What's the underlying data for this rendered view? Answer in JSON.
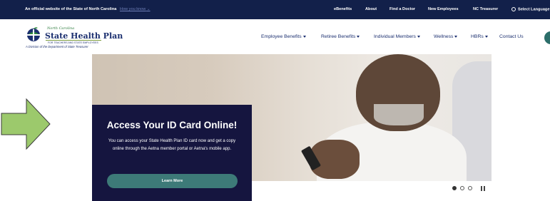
{
  "topbar": {
    "official_text": "An official website of the State of North Carolina",
    "how_you_know": "How you know",
    "links": [
      "eBenefits",
      "About",
      "Find a Doctor",
      "New Employees",
      "NC Treasurer"
    ],
    "language": "Select Language"
  },
  "logo": {
    "script": "North Carolina",
    "main": "State Health Plan",
    "sub": "FOR TEACHERS AND STATE EMPLOYEES",
    "division": "A Division of the Department of State Treasurer"
  },
  "nav": {
    "items": [
      {
        "label": "Employee Benefits",
        "dropdown": true
      },
      {
        "label": "Retiree Benefits",
        "dropdown": true
      },
      {
        "label": "Individual Members",
        "dropdown": true
      },
      {
        "label": "Wellness",
        "dropdown": true
      },
      {
        "label": "HBRs",
        "dropdown": true
      },
      {
        "label": "Contact Us",
        "dropdown": false
      }
    ]
  },
  "hero": {
    "title": "Access Your ID Card Online!",
    "body": "You can access your State Health Plan ID card now and get a copy online through the Aetna member portal or Aetna's mobile app.",
    "button": "Learn More"
  },
  "carousel": {
    "active_slide": 1,
    "total_slides": 3
  },
  "colors": {
    "topbar": "#12204a",
    "brand_navy": "#1b2f6f",
    "card_bg": "#15153f",
    "button_teal": "#3d7a78",
    "arrow_green": "#9cc96c"
  },
  "icons": [
    "chevron-down-icon",
    "globe-icon",
    "caret-down-icon",
    "arrow-right-icon",
    "pause-icon"
  ]
}
